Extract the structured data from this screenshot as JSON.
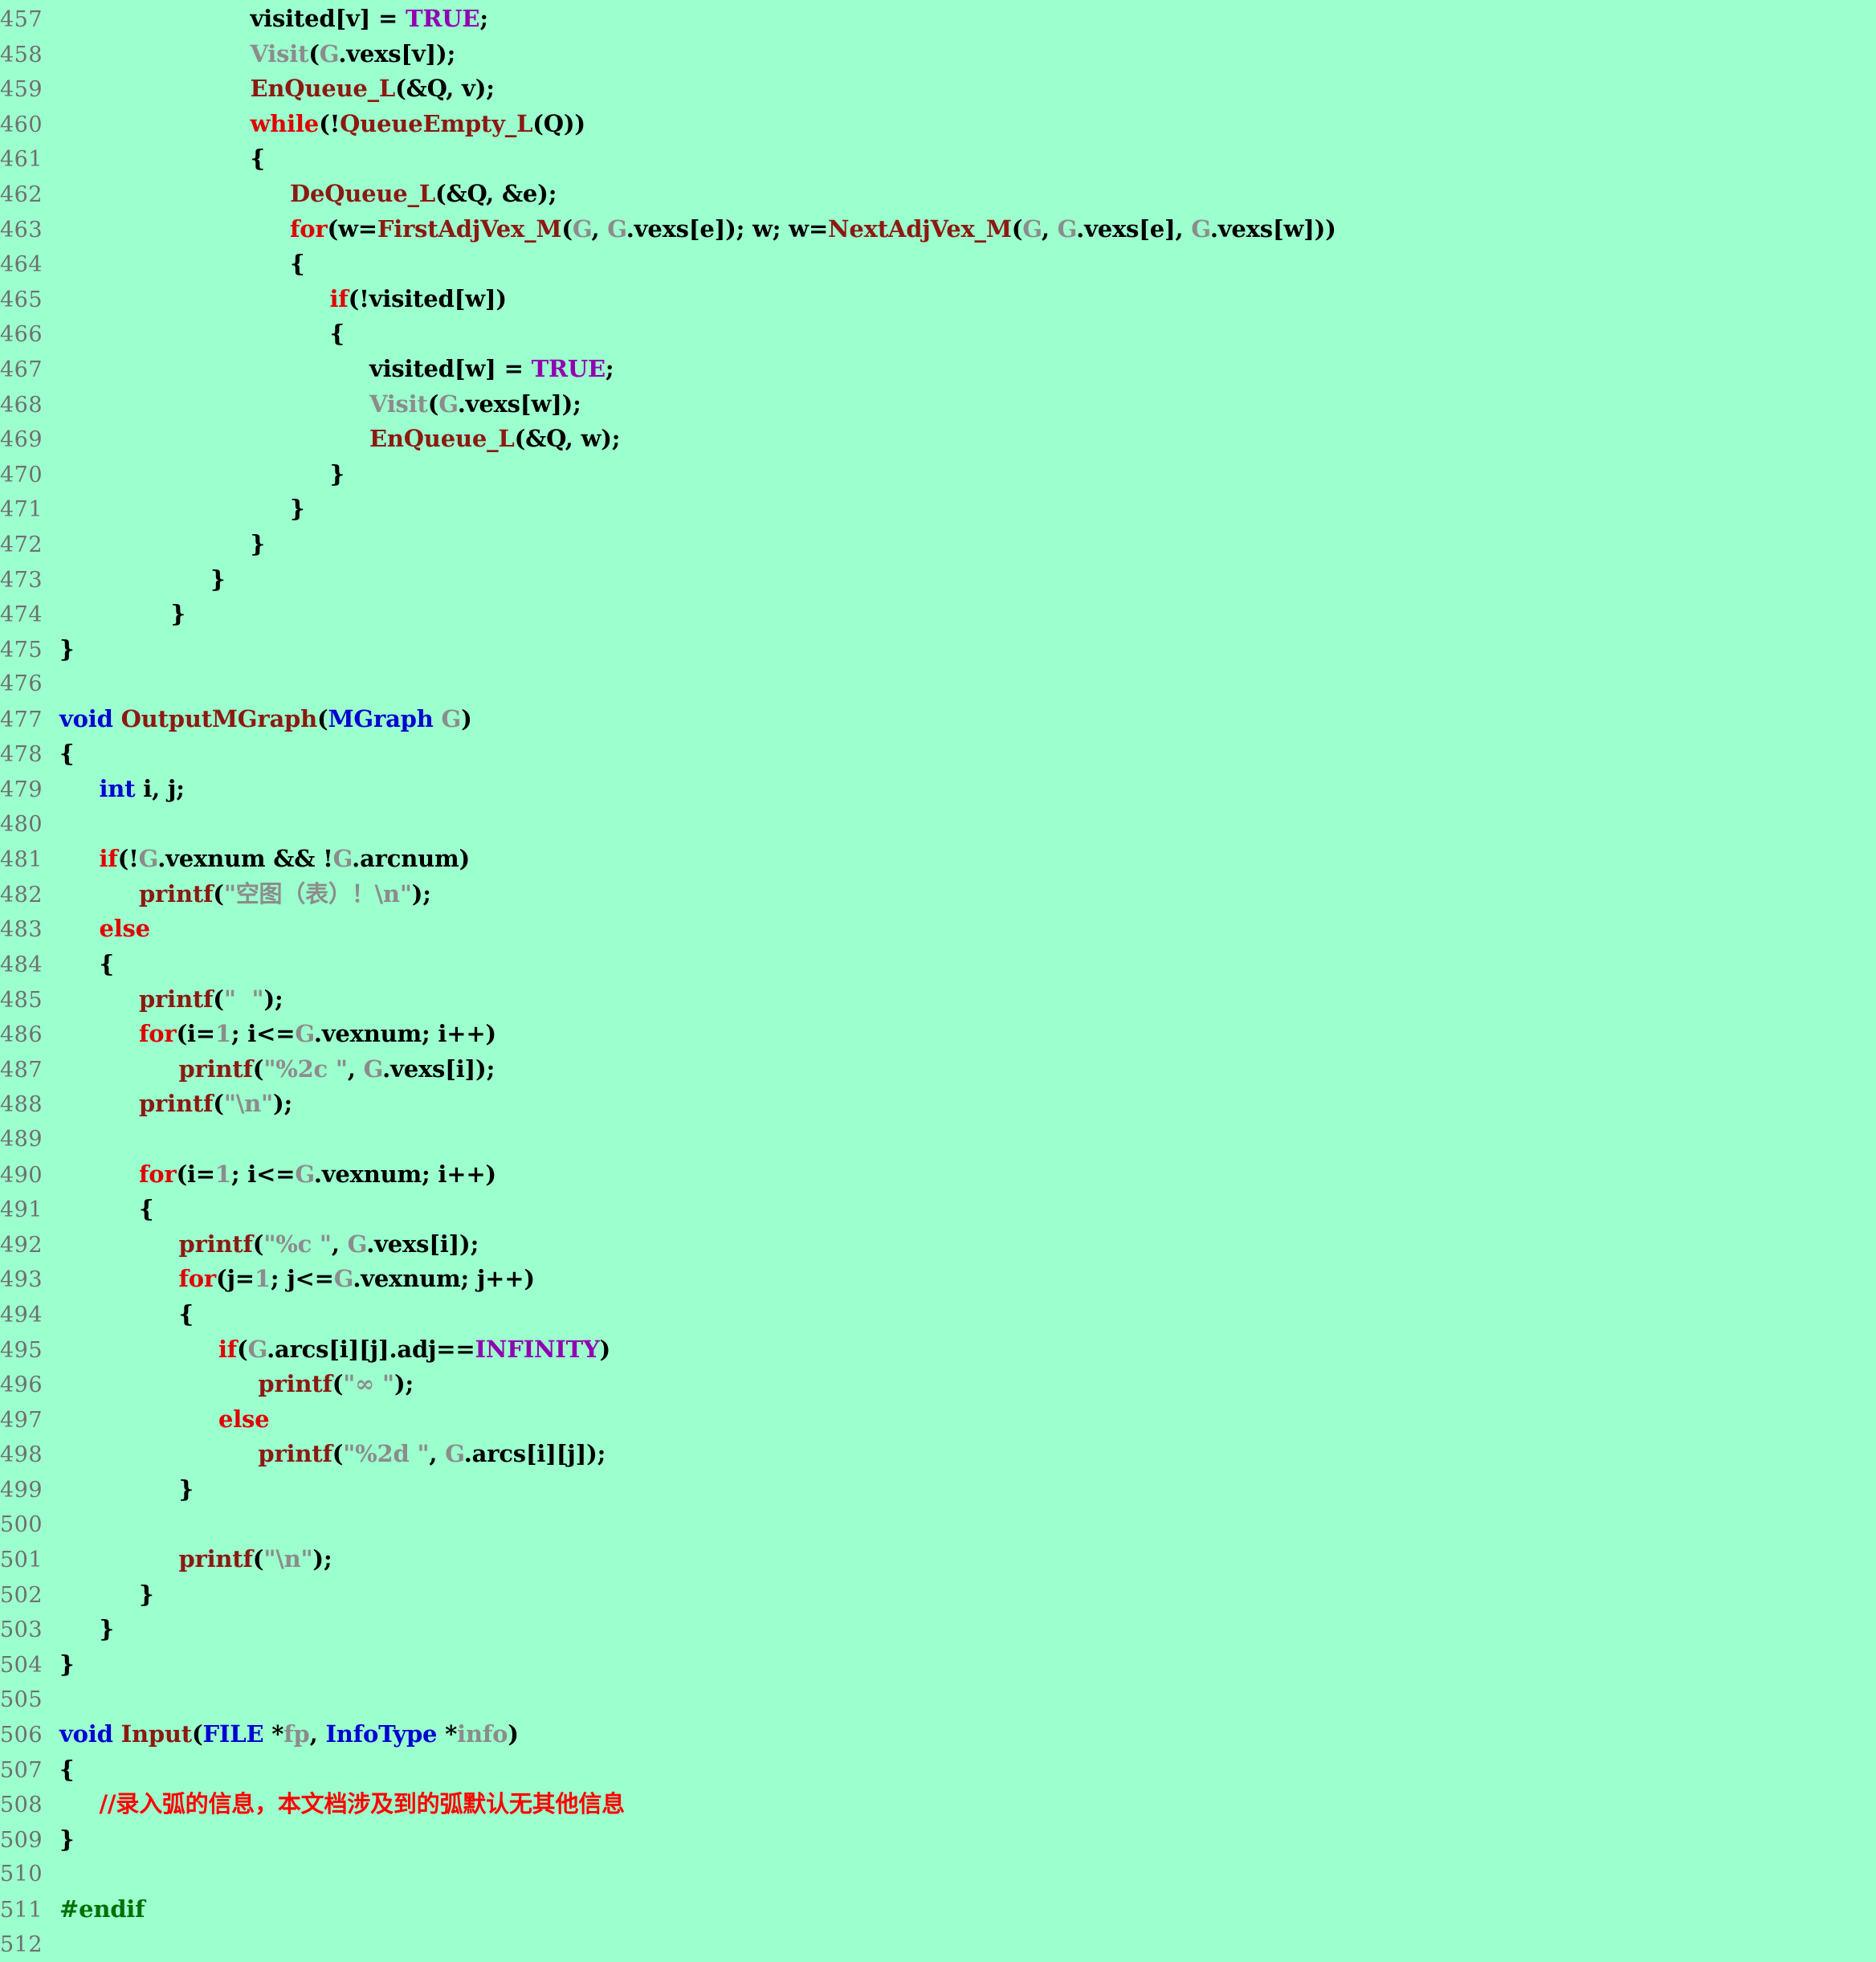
{
  "editor": {
    "background_color": "#9CFFCE",
    "line_number_color": "#6f6f6f",
    "first_line": 457,
    "last_line": 512,
    "language": "c"
  },
  "colors": {
    "keyword": "#E00000",
    "type": "#0000D0",
    "function": "#8B1A11",
    "identifier": "#8C8C8C",
    "constant": "#9000B0",
    "preprocessor": "#007000",
    "comment": "#FF0000",
    "plain": "#000000"
  },
  "lines": [
    {
      "n": "457",
      "tokens": [
        {
          "t": "plain",
          "s": "                        visited[v] = "
        },
        {
          "t": "const",
          "s": "TRUE"
        },
        {
          "t": "plain",
          "s": ";"
        }
      ]
    },
    {
      "n": "458",
      "tokens": [
        {
          "t": "plain",
          "s": "                        "
        },
        {
          "t": "id",
          "s": "Visit"
        },
        {
          "t": "plain",
          "s": "("
        },
        {
          "t": "id",
          "s": "G"
        },
        {
          "t": "plain",
          "s": ".vexs[v]);"
        }
      ]
    },
    {
      "n": "459",
      "tokens": [
        {
          "t": "plain",
          "s": "                        "
        },
        {
          "t": "fn",
          "s": "EnQueue_L"
        },
        {
          "t": "plain",
          "s": "(&Q, v);"
        }
      ]
    },
    {
      "n": "460",
      "tokens": [
        {
          "t": "plain",
          "s": "                        "
        },
        {
          "t": "kw",
          "s": "while"
        },
        {
          "t": "plain",
          "s": "(!"
        },
        {
          "t": "fn",
          "s": "QueueEmpty_L"
        },
        {
          "t": "plain",
          "s": "(Q))"
        }
      ]
    },
    {
      "n": "461",
      "tokens": [
        {
          "t": "plain",
          "s": "                        {"
        }
      ]
    },
    {
      "n": "462",
      "tokens": [
        {
          "t": "plain",
          "s": "                             "
        },
        {
          "t": "fn",
          "s": "DeQueue_L"
        },
        {
          "t": "plain",
          "s": "(&Q, &e);"
        }
      ]
    },
    {
      "n": "463",
      "tokens": [
        {
          "t": "plain",
          "s": "                             "
        },
        {
          "t": "kw",
          "s": "for"
        },
        {
          "t": "plain",
          "s": "(w="
        },
        {
          "t": "fn",
          "s": "FirstAdjVex_M"
        },
        {
          "t": "plain",
          "s": "("
        },
        {
          "t": "id",
          "s": "G"
        },
        {
          "t": "plain",
          "s": ", "
        },
        {
          "t": "id",
          "s": "G"
        },
        {
          "t": "plain",
          "s": ".vexs[e]); w; w="
        },
        {
          "t": "fn",
          "s": "NextAdjVex_M"
        },
        {
          "t": "plain",
          "s": "("
        },
        {
          "t": "id",
          "s": "G"
        },
        {
          "t": "plain",
          "s": ", "
        },
        {
          "t": "id",
          "s": "G"
        },
        {
          "t": "plain",
          "s": ".vexs[e], "
        },
        {
          "t": "id",
          "s": "G"
        },
        {
          "t": "plain",
          "s": ".vexs[w]))"
        }
      ]
    },
    {
      "n": "464",
      "tokens": [
        {
          "t": "plain",
          "s": "                             {"
        }
      ]
    },
    {
      "n": "465",
      "tokens": [
        {
          "t": "plain",
          "s": "                                  "
        },
        {
          "t": "kw",
          "s": "if"
        },
        {
          "t": "plain",
          "s": "(!visited[w])"
        }
      ]
    },
    {
      "n": "466",
      "tokens": [
        {
          "t": "plain",
          "s": "                                  {"
        }
      ]
    },
    {
      "n": "467",
      "tokens": [
        {
          "t": "plain",
          "s": "                                       visited[w] = "
        },
        {
          "t": "const",
          "s": "TRUE"
        },
        {
          "t": "plain",
          "s": ";"
        }
      ]
    },
    {
      "n": "468",
      "tokens": [
        {
          "t": "plain",
          "s": "                                       "
        },
        {
          "t": "id",
          "s": "Visit"
        },
        {
          "t": "plain",
          "s": "("
        },
        {
          "t": "id",
          "s": "G"
        },
        {
          "t": "plain",
          "s": ".vexs[w]);"
        }
      ]
    },
    {
      "n": "469",
      "tokens": [
        {
          "t": "plain",
          "s": "                                       "
        },
        {
          "t": "fn",
          "s": "EnQueue_L"
        },
        {
          "t": "plain",
          "s": "(&Q, w);"
        }
      ]
    },
    {
      "n": "470",
      "tokens": [
        {
          "t": "plain",
          "s": "                                  }"
        }
      ]
    },
    {
      "n": "471",
      "tokens": [
        {
          "t": "plain",
          "s": "                             }"
        }
      ]
    },
    {
      "n": "472",
      "tokens": [
        {
          "t": "plain",
          "s": "                        }"
        }
      ]
    },
    {
      "n": "473",
      "tokens": [
        {
          "t": "plain",
          "s": "                   }"
        }
      ]
    },
    {
      "n": "474",
      "tokens": [
        {
          "t": "plain",
          "s": "              }"
        }
      ]
    },
    {
      "n": "475",
      "tokens": [
        {
          "t": "plain",
          "s": "}"
        }
      ]
    },
    {
      "n": "476",
      "tokens": []
    },
    {
      "n": "477",
      "tokens": [
        {
          "t": "type",
          "s": "void"
        },
        {
          "t": "plain",
          "s": " "
        },
        {
          "t": "fn",
          "s": "OutputMGraph"
        },
        {
          "t": "plain",
          "s": "("
        },
        {
          "t": "type",
          "s": "MGraph"
        },
        {
          "t": "plain",
          "s": " "
        },
        {
          "t": "id",
          "s": "G"
        },
        {
          "t": "plain",
          "s": ")"
        }
      ]
    },
    {
      "n": "478",
      "tokens": [
        {
          "t": "plain",
          "s": "{"
        }
      ]
    },
    {
      "n": "479",
      "tokens": [
        {
          "t": "plain",
          "s": "     "
        },
        {
          "t": "type",
          "s": "int"
        },
        {
          "t": "plain",
          "s": " i, j;"
        }
      ]
    },
    {
      "n": "480",
      "tokens": []
    },
    {
      "n": "481",
      "tokens": [
        {
          "t": "plain",
          "s": "     "
        },
        {
          "t": "kw",
          "s": "if"
        },
        {
          "t": "plain",
          "s": "(!"
        },
        {
          "t": "id",
          "s": "G"
        },
        {
          "t": "plain",
          "s": ".vexnum && !"
        },
        {
          "t": "id",
          "s": "G"
        },
        {
          "t": "plain",
          "s": ".arcnum)"
        }
      ]
    },
    {
      "n": "482",
      "tokens": [
        {
          "t": "plain",
          "s": "          "
        },
        {
          "t": "fn",
          "s": "printf"
        },
        {
          "t": "plain",
          "s": "("
        },
        {
          "t": "id",
          "s": "\"空图（表）！\\n\""
        },
        {
          "t": "plain",
          "s": ");"
        }
      ]
    },
    {
      "n": "483",
      "tokens": [
        {
          "t": "plain",
          "s": "     "
        },
        {
          "t": "kw",
          "s": "else"
        }
      ]
    },
    {
      "n": "484",
      "tokens": [
        {
          "t": "plain",
          "s": "     {"
        }
      ]
    },
    {
      "n": "485",
      "tokens": [
        {
          "t": "plain",
          "s": "          "
        },
        {
          "t": "fn",
          "s": "printf"
        },
        {
          "t": "plain",
          "s": "("
        },
        {
          "t": "id",
          "s": "\"  \""
        },
        {
          "t": "plain",
          "s": ");"
        }
      ]
    },
    {
      "n": "486",
      "tokens": [
        {
          "t": "plain",
          "s": "          "
        },
        {
          "t": "kw",
          "s": "for"
        },
        {
          "t": "plain",
          "s": "(i="
        },
        {
          "t": "id",
          "s": "1"
        },
        {
          "t": "plain",
          "s": "; i<="
        },
        {
          "t": "id",
          "s": "G"
        },
        {
          "t": "plain",
          "s": ".vexnum; i++)"
        }
      ]
    },
    {
      "n": "487",
      "tokens": [
        {
          "t": "plain",
          "s": "               "
        },
        {
          "t": "fn",
          "s": "printf"
        },
        {
          "t": "plain",
          "s": "("
        },
        {
          "t": "id",
          "s": "\"%2c \""
        },
        {
          "t": "plain",
          "s": ", "
        },
        {
          "t": "id",
          "s": "G"
        },
        {
          "t": "plain",
          "s": ".vexs[i]);"
        }
      ]
    },
    {
      "n": "488",
      "tokens": [
        {
          "t": "plain",
          "s": "          "
        },
        {
          "t": "fn",
          "s": "printf"
        },
        {
          "t": "plain",
          "s": "("
        },
        {
          "t": "id",
          "s": "\"\\n\""
        },
        {
          "t": "plain",
          "s": ");"
        }
      ]
    },
    {
      "n": "489",
      "tokens": []
    },
    {
      "n": "490",
      "tokens": [
        {
          "t": "plain",
          "s": "          "
        },
        {
          "t": "kw",
          "s": "for"
        },
        {
          "t": "plain",
          "s": "(i="
        },
        {
          "t": "id",
          "s": "1"
        },
        {
          "t": "plain",
          "s": "; i<="
        },
        {
          "t": "id",
          "s": "G"
        },
        {
          "t": "plain",
          "s": ".vexnum; i++)"
        }
      ]
    },
    {
      "n": "491",
      "tokens": [
        {
          "t": "plain",
          "s": "          {"
        }
      ]
    },
    {
      "n": "492",
      "tokens": [
        {
          "t": "plain",
          "s": "               "
        },
        {
          "t": "fn",
          "s": "printf"
        },
        {
          "t": "plain",
          "s": "("
        },
        {
          "t": "id",
          "s": "\"%c \""
        },
        {
          "t": "plain",
          "s": ", "
        },
        {
          "t": "id",
          "s": "G"
        },
        {
          "t": "plain",
          "s": ".vexs[i]);"
        }
      ]
    },
    {
      "n": "493",
      "tokens": [
        {
          "t": "plain",
          "s": "               "
        },
        {
          "t": "kw",
          "s": "for"
        },
        {
          "t": "plain",
          "s": "(j="
        },
        {
          "t": "id",
          "s": "1"
        },
        {
          "t": "plain",
          "s": "; j<="
        },
        {
          "t": "id",
          "s": "G"
        },
        {
          "t": "plain",
          "s": ".vexnum; j++)"
        }
      ]
    },
    {
      "n": "494",
      "tokens": [
        {
          "t": "plain",
          "s": "               {"
        }
      ]
    },
    {
      "n": "495",
      "tokens": [
        {
          "t": "plain",
          "s": "                    "
        },
        {
          "t": "kw",
          "s": "if"
        },
        {
          "t": "plain",
          "s": "("
        },
        {
          "t": "id",
          "s": "G"
        },
        {
          "t": "plain",
          "s": ".arcs[i][j].adj=="
        },
        {
          "t": "const",
          "s": "INFINITY"
        },
        {
          "t": "plain",
          "s": ")"
        }
      ]
    },
    {
      "n": "496",
      "tokens": [
        {
          "t": "plain",
          "s": "                         "
        },
        {
          "t": "fn",
          "s": "printf"
        },
        {
          "t": "plain",
          "s": "("
        },
        {
          "t": "id",
          "s": "\"∞ \""
        },
        {
          "t": "plain",
          "s": ");"
        }
      ]
    },
    {
      "n": "497",
      "tokens": [
        {
          "t": "plain",
          "s": "                    "
        },
        {
          "t": "kw",
          "s": "else"
        }
      ]
    },
    {
      "n": "498",
      "tokens": [
        {
          "t": "plain",
          "s": "                         "
        },
        {
          "t": "fn",
          "s": "printf"
        },
        {
          "t": "plain",
          "s": "("
        },
        {
          "t": "id",
          "s": "\"%2d \""
        },
        {
          "t": "plain",
          "s": ", "
        },
        {
          "t": "id",
          "s": "G"
        },
        {
          "t": "plain",
          "s": ".arcs[i][j]);"
        }
      ]
    },
    {
      "n": "499",
      "tokens": [
        {
          "t": "plain",
          "s": "               }"
        }
      ]
    },
    {
      "n": "500",
      "tokens": []
    },
    {
      "n": "501",
      "tokens": [
        {
          "t": "plain",
          "s": "               "
        },
        {
          "t": "fn",
          "s": "printf"
        },
        {
          "t": "plain",
          "s": "("
        },
        {
          "t": "id",
          "s": "\"\\n\""
        },
        {
          "t": "plain",
          "s": ");"
        }
      ]
    },
    {
      "n": "502",
      "tokens": [
        {
          "t": "plain",
          "s": "          }"
        }
      ]
    },
    {
      "n": "503",
      "tokens": [
        {
          "t": "plain",
          "s": "     }"
        }
      ]
    },
    {
      "n": "504",
      "tokens": [
        {
          "t": "plain",
          "s": "}"
        }
      ]
    },
    {
      "n": "505",
      "tokens": []
    },
    {
      "n": "506",
      "tokens": [
        {
          "t": "type",
          "s": "void"
        },
        {
          "t": "plain",
          "s": " "
        },
        {
          "t": "fn",
          "s": "Input"
        },
        {
          "t": "plain",
          "s": "("
        },
        {
          "t": "type",
          "s": "FILE"
        },
        {
          "t": "plain",
          "s": " *"
        },
        {
          "t": "id",
          "s": "fp"
        },
        {
          "t": "plain",
          "s": ", "
        },
        {
          "t": "type",
          "s": "InfoType"
        },
        {
          "t": "plain",
          "s": " *"
        },
        {
          "t": "id",
          "s": "info"
        },
        {
          "t": "plain",
          "s": ")"
        }
      ]
    },
    {
      "n": "507",
      "tokens": [
        {
          "t": "plain",
          "s": "{"
        }
      ]
    },
    {
      "n": "508",
      "tokens": [
        {
          "t": "plain",
          "s": "     "
        },
        {
          "t": "cmt",
          "s": "//录入弧的信息，本文档涉及到的弧默认无其他信息"
        }
      ]
    },
    {
      "n": "509",
      "tokens": [
        {
          "t": "plain",
          "s": "}"
        }
      ]
    },
    {
      "n": "510",
      "tokens": []
    },
    {
      "n": "511",
      "tokens": [
        {
          "t": "pre",
          "s": "#endif"
        }
      ]
    },
    {
      "n": "512",
      "tokens": []
    }
  ]
}
